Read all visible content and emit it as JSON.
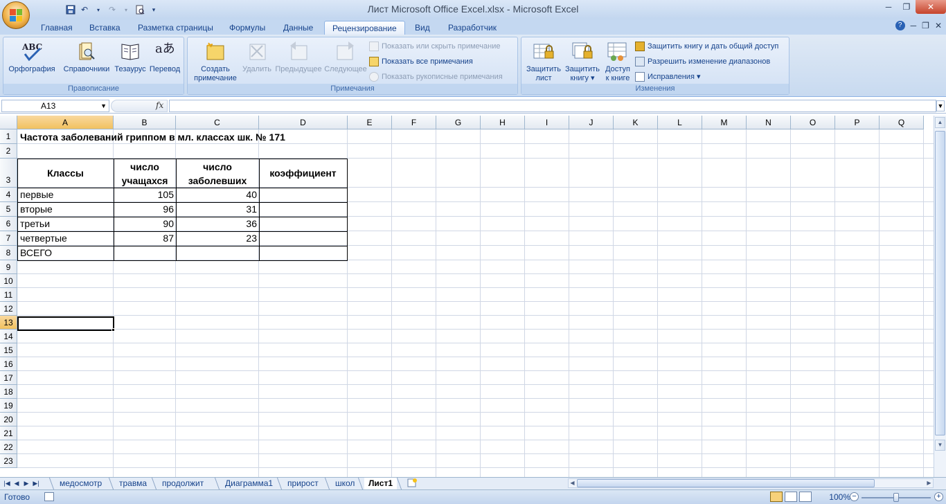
{
  "window": {
    "title": "Лист Microsoft Office Excel.xlsx - Microsoft Excel",
    "qat_icons": [
      "save-icon",
      "undo-icon",
      "redo-icon",
      "print-preview-icon",
      "customize-icon"
    ],
    "controls": {
      "minimize": "─",
      "restore": "❐",
      "close": "✕"
    }
  },
  "ribbon_tabs": [
    "Главная",
    "Вставка",
    "Разметка страницы",
    "Формулы",
    "Данные",
    "Рецензирование",
    "Вид",
    "Разработчик"
  ],
  "active_tab": "Рецензирование",
  "ribbon_groups": {
    "proofing": {
      "label": "Правописание",
      "buttons": [
        "Орфография",
        "Справочники",
        "Тезаурус",
        "Перевод"
      ],
      "spelling_icon_text": "ABC",
      "translate_icon_text": "aあ"
    },
    "comments": {
      "label": "Примечания",
      "new_comment": [
        "Создать",
        "примечание"
      ],
      "delete": "Удалить",
      "previous": "Предыдущее",
      "next": "Следующее",
      "show_hide": "Показать или скрыть примечание",
      "show_all": "Показать все примечания",
      "show_ink": "Показать рукописные примечания"
    },
    "changes": {
      "label": "Изменения",
      "protect_sheet": [
        "Защитить",
        "лист"
      ],
      "protect_workbook": [
        "Защитить",
        "книгу ▾"
      ],
      "share_workbook": [
        "Доступ",
        "к книге"
      ],
      "protect_share": "Защитить книгу и дать общий доступ",
      "allow_ranges": "Разрешить изменение диапазонов",
      "track_changes": "Исправления ▾"
    }
  },
  "formula_bar": {
    "name_box": "A13",
    "fx": "fx",
    "formula": ""
  },
  "columns": [
    "A",
    "B",
    "C",
    "D",
    "E",
    "F",
    "G",
    "H",
    "I",
    "J",
    "K",
    "L",
    "M",
    "N",
    "O",
    "P",
    "Q"
  ],
  "rows": [
    "1",
    "2",
    "3",
    "4",
    "5",
    "6",
    "7",
    "8",
    "9",
    "10",
    "11",
    "12",
    "13",
    "14",
    "15",
    "16",
    "17",
    "18",
    "19",
    "20",
    "21",
    "22",
    "23"
  ],
  "sheet": {
    "title": "Частота заболеваний гриппом в мл. классах шк. № 171",
    "headers": {
      "classes": "Классы",
      "students": [
        "число",
        "учащахся"
      ],
      "sick": [
        "число",
        "заболевших"
      ],
      "coef": "коэффициент"
    },
    "data_rows": [
      {
        "name": "первые",
        "students": "105",
        "sick": "40"
      },
      {
        "name": "вторые",
        "students": "96",
        "sick": "31"
      },
      {
        "name": "третьи",
        "students": "90",
        "sick": "36"
      },
      {
        "name": "четвертые",
        "students": "87",
        "sick": "23"
      }
    ],
    "total_label": "ВСЕГО"
  },
  "sheet_tabs": [
    "медосмотр",
    "травма",
    "продолжит",
    "Диаграмма1",
    "прирост",
    "школ",
    "Лист1"
  ],
  "active_sheet": "Лист1",
  "status": {
    "text": "Готово",
    "zoom": "100%"
  }
}
